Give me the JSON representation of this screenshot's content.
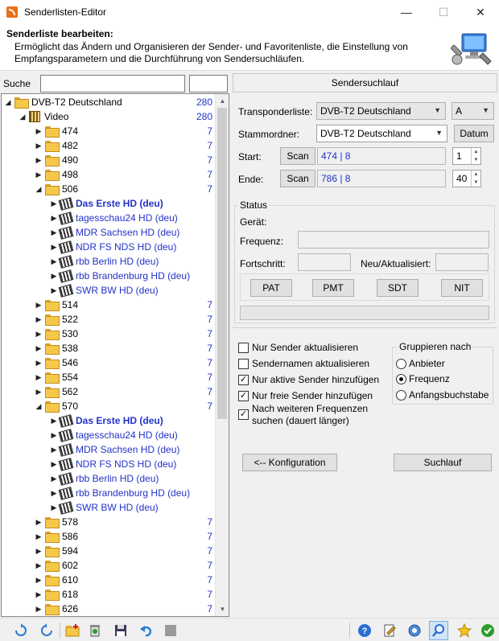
{
  "window": {
    "title": "Senderlisten-Editor",
    "minimize": "—",
    "maximize": "☐",
    "close": "✕"
  },
  "header": {
    "title": "Senderliste bearbeiten:",
    "description": "Ermöglicht das Ändern und Organisieren der Sender- und Favoritenliste, die Einstellung von Empfangsparametern und die Durchführung von Sendersuchläufen."
  },
  "search": {
    "label": "Suche",
    "value": "",
    "value2": ""
  },
  "tree": {
    "root": {
      "label": "DVB-T2 Deutschland",
      "count": "280"
    },
    "video": {
      "label": "Video",
      "count": "280"
    },
    "rows": [
      {
        "type": "folder",
        "label": "474",
        "count": "7"
      },
      {
        "type": "folder",
        "label": "482",
        "count": "7"
      },
      {
        "type": "folder",
        "label": "490",
        "count": "7"
      },
      {
        "type": "folder",
        "label": "498",
        "count": "7"
      },
      {
        "type": "folder",
        "label": "506",
        "count": "7",
        "open": true
      },
      {
        "type": "channel",
        "label": "Das Erste HD (deu)",
        "bold": true
      },
      {
        "type": "channel",
        "label": "tagesschau24 HD (deu)"
      },
      {
        "type": "channel",
        "label": "MDR Sachsen HD (deu)"
      },
      {
        "type": "channel",
        "label": "NDR FS NDS HD (deu)"
      },
      {
        "type": "channel",
        "label": "rbb Berlin HD (deu)"
      },
      {
        "type": "channel",
        "label": "rbb Brandenburg HD (deu)"
      },
      {
        "type": "channel",
        "label": "SWR BW HD (deu)"
      },
      {
        "type": "folder",
        "label": "514",
        "count": "7"
      },
      {
        "type": "folder",
        "label": "522",
        "count": "7"
      },
      {
        "type": "folder",
        "label": "530",
        "count": "7"
      },
      {
        "type": "folder",
        "label": "538",
        "count": "7"
      },
      {
        "type": "folder",
        "label": "546",
        "count": "7"
      },
      {
        "type": "folder",
        "label": "554",
        "count": "7"
      },
      {
        "type": "folder",
        "label": "562",
        "count": "7"
      },
      {
        "type": "folder",
        "label": "570",
        "count": "7",
        "open": true
      },
      {
        "type": "channel",
        "label": "Das Erste HD (deu)",
        "bold": true
      },
      {
        "type": "channel",
        "label": "tagesschau24 HD (deu)"
      },
      {
        "type": "channel",
        "label": "MDR Sachsen HD (deu)"
      },
      {
        "type": "channel",
        "label": "NDR FS NDS HD (deu)"
      },
      {
        "type": "channel",
        "label": "rbb Berlin HD (deu)"
      },
      {
        "type": "channel",
        "label": "rbb Brandenburg HD (deu)"
      },
      {
        "type": "channel",
        "label": "SWR BW HD (deu)"
      },
      {
        "type": "folder",
        "label": "578",
        "count": "7"
      },
      {
        "type": "folder",
        "label": "586",
        "count": "7"
      },
      {
        "type": "folder",
        "label": "594",
        "count": "7"
      },
      {
        "type": "folder",
        "label": "602",
        "count": "7"
      },
      {
        "type": "folder",
        "label": "610",
        "count": "7"
      },
      {
        "type": "folder",
        "label": "618",
        "count": "7"
      },
      {
        "type": "folder",
        "label": "626",
        "count": "7"
      }
    ]
  },
  "scan": {
    "heading": "Sendersuchlauf",
    "transponder_label": "Transponderliste:",
    "transponder_value": "DVB-T2 Deutschland",
    "transponder_letter": "A",
    "root_label": "Stammordner:",
    "root_value": "DVB-T2 Deutschland",
    "datum_button": "Datum",
    "start_label": "Start:",
    "start_scan": "Scan",
    "start_value": "474 | 8",
    "start_spin": "1",
    "end_label": "Ende:",
    "end_scan": "Scan",
    "end_value": "786 | 8",
    "end_spin": "40"
  },
  "status": {
    "title": "Status",
    "device_label": "Gerät:",
    "freq_label": "Frequenz:",
    "progress_label": "Fortschritt:",
    "new_label": "Neu/Aktualisiert:",
    "buttons": [
      "PAT",
      "PMT",
      "SDT",
      "NIT"
    ]
  },
  "options": {
    "checkboxes": [
      {
        "label": "Nur Sender aktualisieren",
        "checked": false
      },
      {
        "label": "Sendernamen aktualisieren",
        "checked": false
      },
      {
        "label": "Nur aktive Sender hinzufügen",
        "checked": true
      },
      {
        "label": "Nur freie Sender hinzufügen",
        "checked": true
      },
      {
        "label": "Nach weiteren Frequenzen",
        "label2": "suchen (dauert länger)",
        "checked": true
      }
    ],
    "group_title": "Gruppieren nach",
    "radios": [
      {
        "label": "Anbieter",
        "selected": false
      },
      {
        "label": "Frequenz",
        "selected": true
      },
      {
        "label": "Anfangsbuchstabe",
        "selected": false
      }
    ]
  },
  "actions": {
    "config_button": "<-- Konfiguration",
    "search_button": "Suchlauf"
  },
  "toolbar": {
    "left_icons": [
      "refresh-icon",
      "refresh-alt-icon",
      "new-folder-icon",
      "delete-icon",
      "save-icon",
      "undo-icon",
      "disabled-icon"
    ],
    "right_icons": [
      "help-icon",
      "edit-icon",
      "settings-icon",
      "search-icon",
      "favorite-icon",
      "ok-icon"
    ]
  },
  "colors": {
    "link_blue": "#2232c8",
    "count_blue": "#1f35c8",
    "folder": "#f5c84a"
  }
}
